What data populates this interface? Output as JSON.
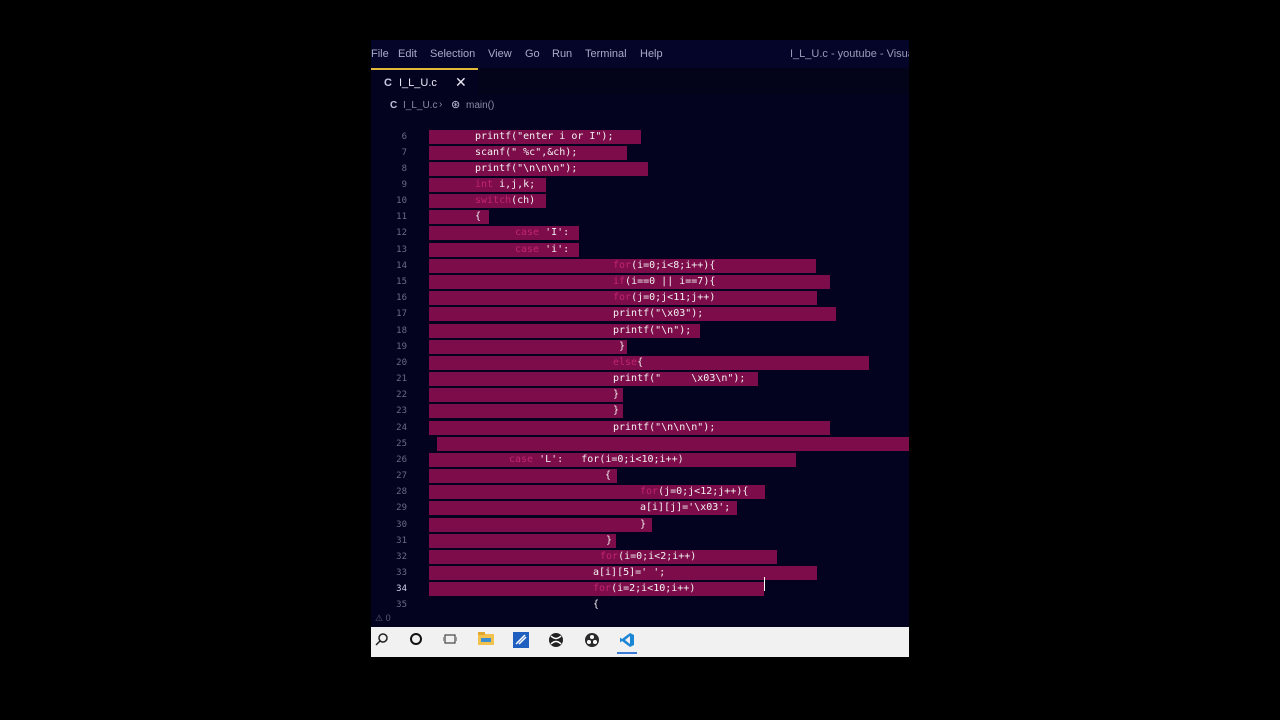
{
  "menubar": {
    "items": [
      "File",
      "Edit",
      "Selection",
      "View",
      "Go",
      "Run",
      "Terminal",
      "Help"
    ],
    "window_title": "I_L_U.c - youtube - Visual S"
  },
  "tab": {
    "label": "I_L_U.c",
    "icon": "c-file-icon",
    "close": "✕"
  },
  "breadcrumb": {
    "file": "I_L_U.c",
    "separator": "›",
    "function": "main()",
    "function_icon": "symbol-method-icon"
  },
  "editor": {
    "active_line": "34",
    "lines": [
      {
        "n": "6",
        "text": "printf(\"enter i or I\");"
      },
      {
        "n": "7",
        "text": "scanf(\" %c\",&ch);"
      },
      {
        "n": "8",
        "text": "printf(\"\\n\\n\\n\");"
      },
      {
        "n": "9",
        "kw": "int",
        "text": " i,j,k;"
      },
      {
        "n": "10",
        "kw": "switch",
        "text": "(ch)"
      },
      {
        "n": "11",
        "text": "{"
      },
      {
        "n": "12",
        "kw": "case",
        "text": " 'I':"
      },
      {
        "n": "13",
        "kw": "case",
        "text": " 'i':"
      },
      {
        "n": "14",
        "kw": "for",
        "text": "(i=0;i<8;i++){"
      },
      {
        "n": "15",
        "kw": "if",
        "text": "(i==0 || i==7){"
      },
      {
        "n": "16",
        "kw": "for",
        "text": "(j=0;j<11;j++)"
      },
      {
        "n": "17",
        "text": "printf(\"\\x03\");"
      },
      {
        "n": "18",
        "text": "printf(\"\\n\");"
      },
      {
        "n": "19",
        "text": "}"
      },
      {
        "n": "20",
        "kw": "else",
        "text": "{"
      },
      {
        "n": "21",
        "text": "printf(\"     \\x03\\n\");"
      },
      {
        "n": "22",
        "text": "}"
      },
      {
        "n": "23",
        "text": "}"
      },
      {
        "n": "24",
        "text": "printf(\"\\n\\n\\n\");"
      },
      {
        "n": "25",
        "text": ""
      },
      {
        "n": "26",
        "kw": "case",
        "text": " 'L':   for(i=0;i<10;i++)"
      },
      {
        "n": "27",
        "text": "{"
      },
      {
        "n": "28",
        "kw": "for",
        "text": "(j=0;j<12;j++){"
      },
      {
        "n": "29",
        "text": "a[i][j]='\\x03';"
      },
      {
        "n": "30",
        "text": "}"
      },
      {
        "n": "31",
        "text": "}"
      },
      {
        "n": "32",
        "kw": "for",
        "text": "(i=0;i<2;i++)"
      },
      {
        "n": "33",
        "text": "a[i][5]=' ';"
      },
      {
        "n": "34",
        "kw": "for",
        "text": "(i=2;i<10;i++)"
      },
      {
        "n": "35",
        "text": "{"
      }
    ]
  },
  "statusbar": {
    "problems": "⚠ 0"
  },
  "taskbar": {
    "icons": [
      "search-icon",
      "cortana-icon",
      "task-view-icon",
      "file-explorer-icon",
      "visual-studio-icon",
      "xbox-icon",
      "obs-icon",
      "vscode-icon"
    ]
  },
  "colors": {
    "selection": "#7d0d4a",
    "keyword": "#c22472",
    "background": "#03031f",
    "tab_accent": "#e3b93a"
  }
}
